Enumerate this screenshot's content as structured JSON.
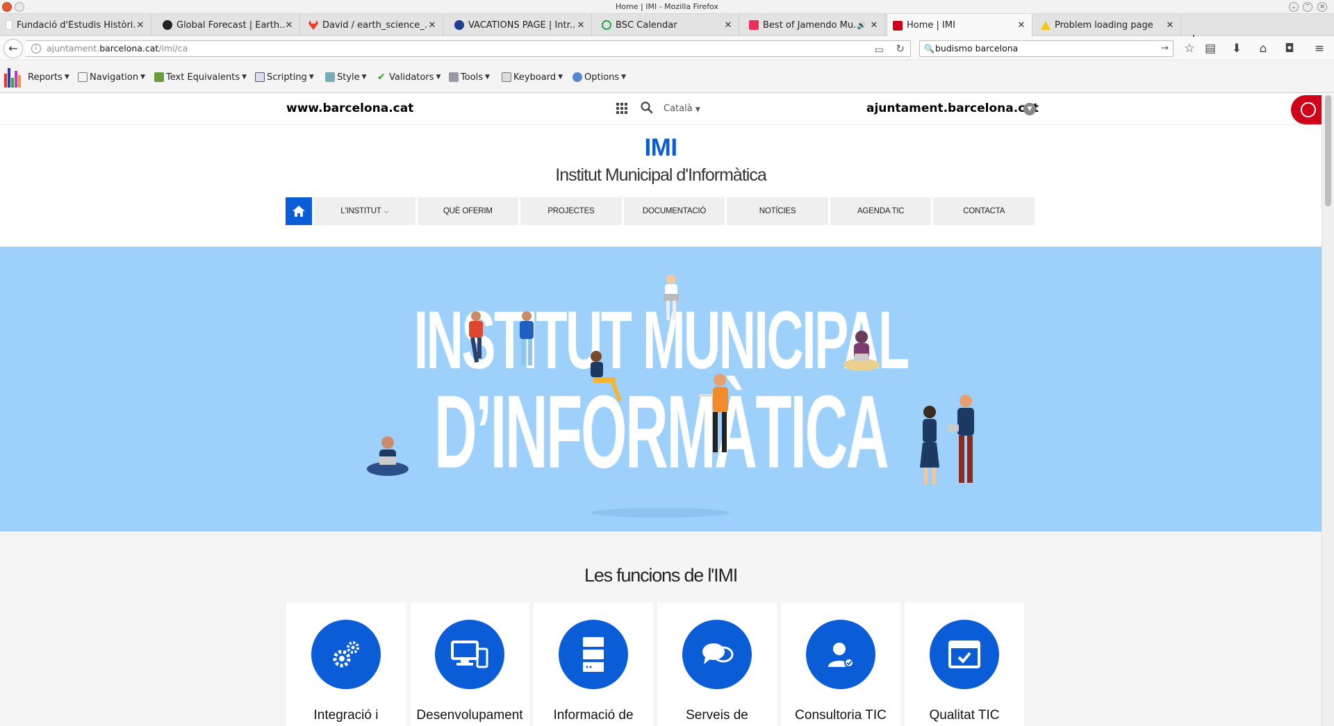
{
  "window": {
    "title": "Home | IMI - Mozilla Firefox"
  },
  "tabs": [
    {
      "label": "Fundació d'Estudis Històri...",
      "icon": "blank-page-icon"
    },
    {
      "label": "Global Forecast | Earth...",
      "icon": "earth-globe-icon"
    },
    {
      "label": "David / earth_science_...",
      "icon": "gitlab-fox-icon"
    },
    {
      "label": "VACATIONS PAGE | Intr...",
      "icon": "intranet-icon"
    },
    {
      "label": "BSC Calendar",
      "icon": "calendar-circle-icon"
    },
    {
      "label": "Best of Jamendo Mu...",
      "icon": "jamendo-icon",
      "audio": true
    },
    {
      "label": "Home | IMI",
      "icon": "barcelona-shield-icon",
      "active": true
    },
    {
      "label": "Problem loading page",
      "icon": "warning-icon"
    }
  ],
  "navbar": {
    "url_prefix": "ajuntament.",
    "url_domain": "barcelona.cat",
    "url_path": "/imi/ca",
    "search_value": "budismo barcelona"
  },
  "devtoolbar": {
    "items": [
      "Reports",
      "Navigation",
      "Text Equivalents",
      "Scripting",
      "Style",
      "Validators",
      "Tools",
      "Keyboard",
      "Options"
    ]
  },
  "site": {
    "left_link": "www.barcelona.cat",
    "language": "Català",
    "right_link": "ajuntament.barcelona.cat",
    "title": "IMI",
    "subtitle": "Institut Municipal d'Informàtica",
    "accent_color": "#0b5cd7",
    "hero_color": "#9dd1fb"
  },
  "mainnav": [
    "L'INSTITUT",
    "QUÈ OFERIM",
    "PROJECTES",
    "DOCUMENTACIÓ",
    "NOTÍCIES",
    "AGENDA TIC",
    "CONTACTA"
  ],
  "hero": {
    "line1": "INSTITUT MUNICIPAL",
    "line2": "D’INFORMÀTICA"
  },
  "funcions": {
    "title": "Les funcions de l'IMI",
    "cards": [
      {
        "label": "Integració i",
        "icon": "gears-icon"
      },
      {
        "label": "Desenvolupament",
        "icon": "devices-icon"
      },
      {
        "label": "Informació de",
        "icon": "server-icon"
      },
      {
        "label": "Serveis de",
        "icon": "chat-bubbles-icon"
      },
      {
        "label": "Consultoria TIC",
        "icon": "consultant-icon"
      },
      {
        "label": "Qualitat TIC",
        "icon": "browser-check-icon"
      }
    ]
  }
}
